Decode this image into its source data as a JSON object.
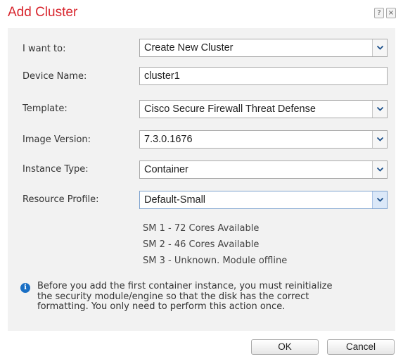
{
  "dialog": {
    "title": "Add Cluster",
    "help_label": "?",
    "close_label": "×"
  },
  "form": {
    "i_want_to": {
      "label": "I want to:",
      "value": "Create New Cluster"
    },
    "device_name": {
      "label": "Device Name:",
      "value": "cluster1"
    },
    "template": {
      "label": "Template:",
      "value": "Cisco Secure Firewall Threat Defense"
    },
    "image_version": {
      "label": "Image Version:",
      "value": "7.3.0.1676"
    },
    "instance_type": {
      "label": "Instance Type:",
      "value": "Container"
    },
    "resource_profile": {
      "label": "Resource Profile:",
      "value": "Default-Small"
    }
  },
  "modules": [
    "SM 1 - 72 Cores Available",
    "SM 2 - 46 Cores Available",
    "SM 3 - Unknown. Module offline"
  ],
  "info": {
    "icon": "info-icon",
    "icon_glyph": "i",
    "line1": "Before you add the first container instance, you must reinitialize",
    "line2": "the security module/engine so that the disk has the correct",
    "line3": "formatting. You only need to perform this action once."
  },
  "buttons": {
    "ok": "OK",
    "cancel": "Cancel"
  },
  "colors": {
    "title": "#d8262e",
    "panel_bg": "#f2f2f2",
    "info_icon": "#1a6fc4",
    "focus_border": "#7da2ce"
  }
}
